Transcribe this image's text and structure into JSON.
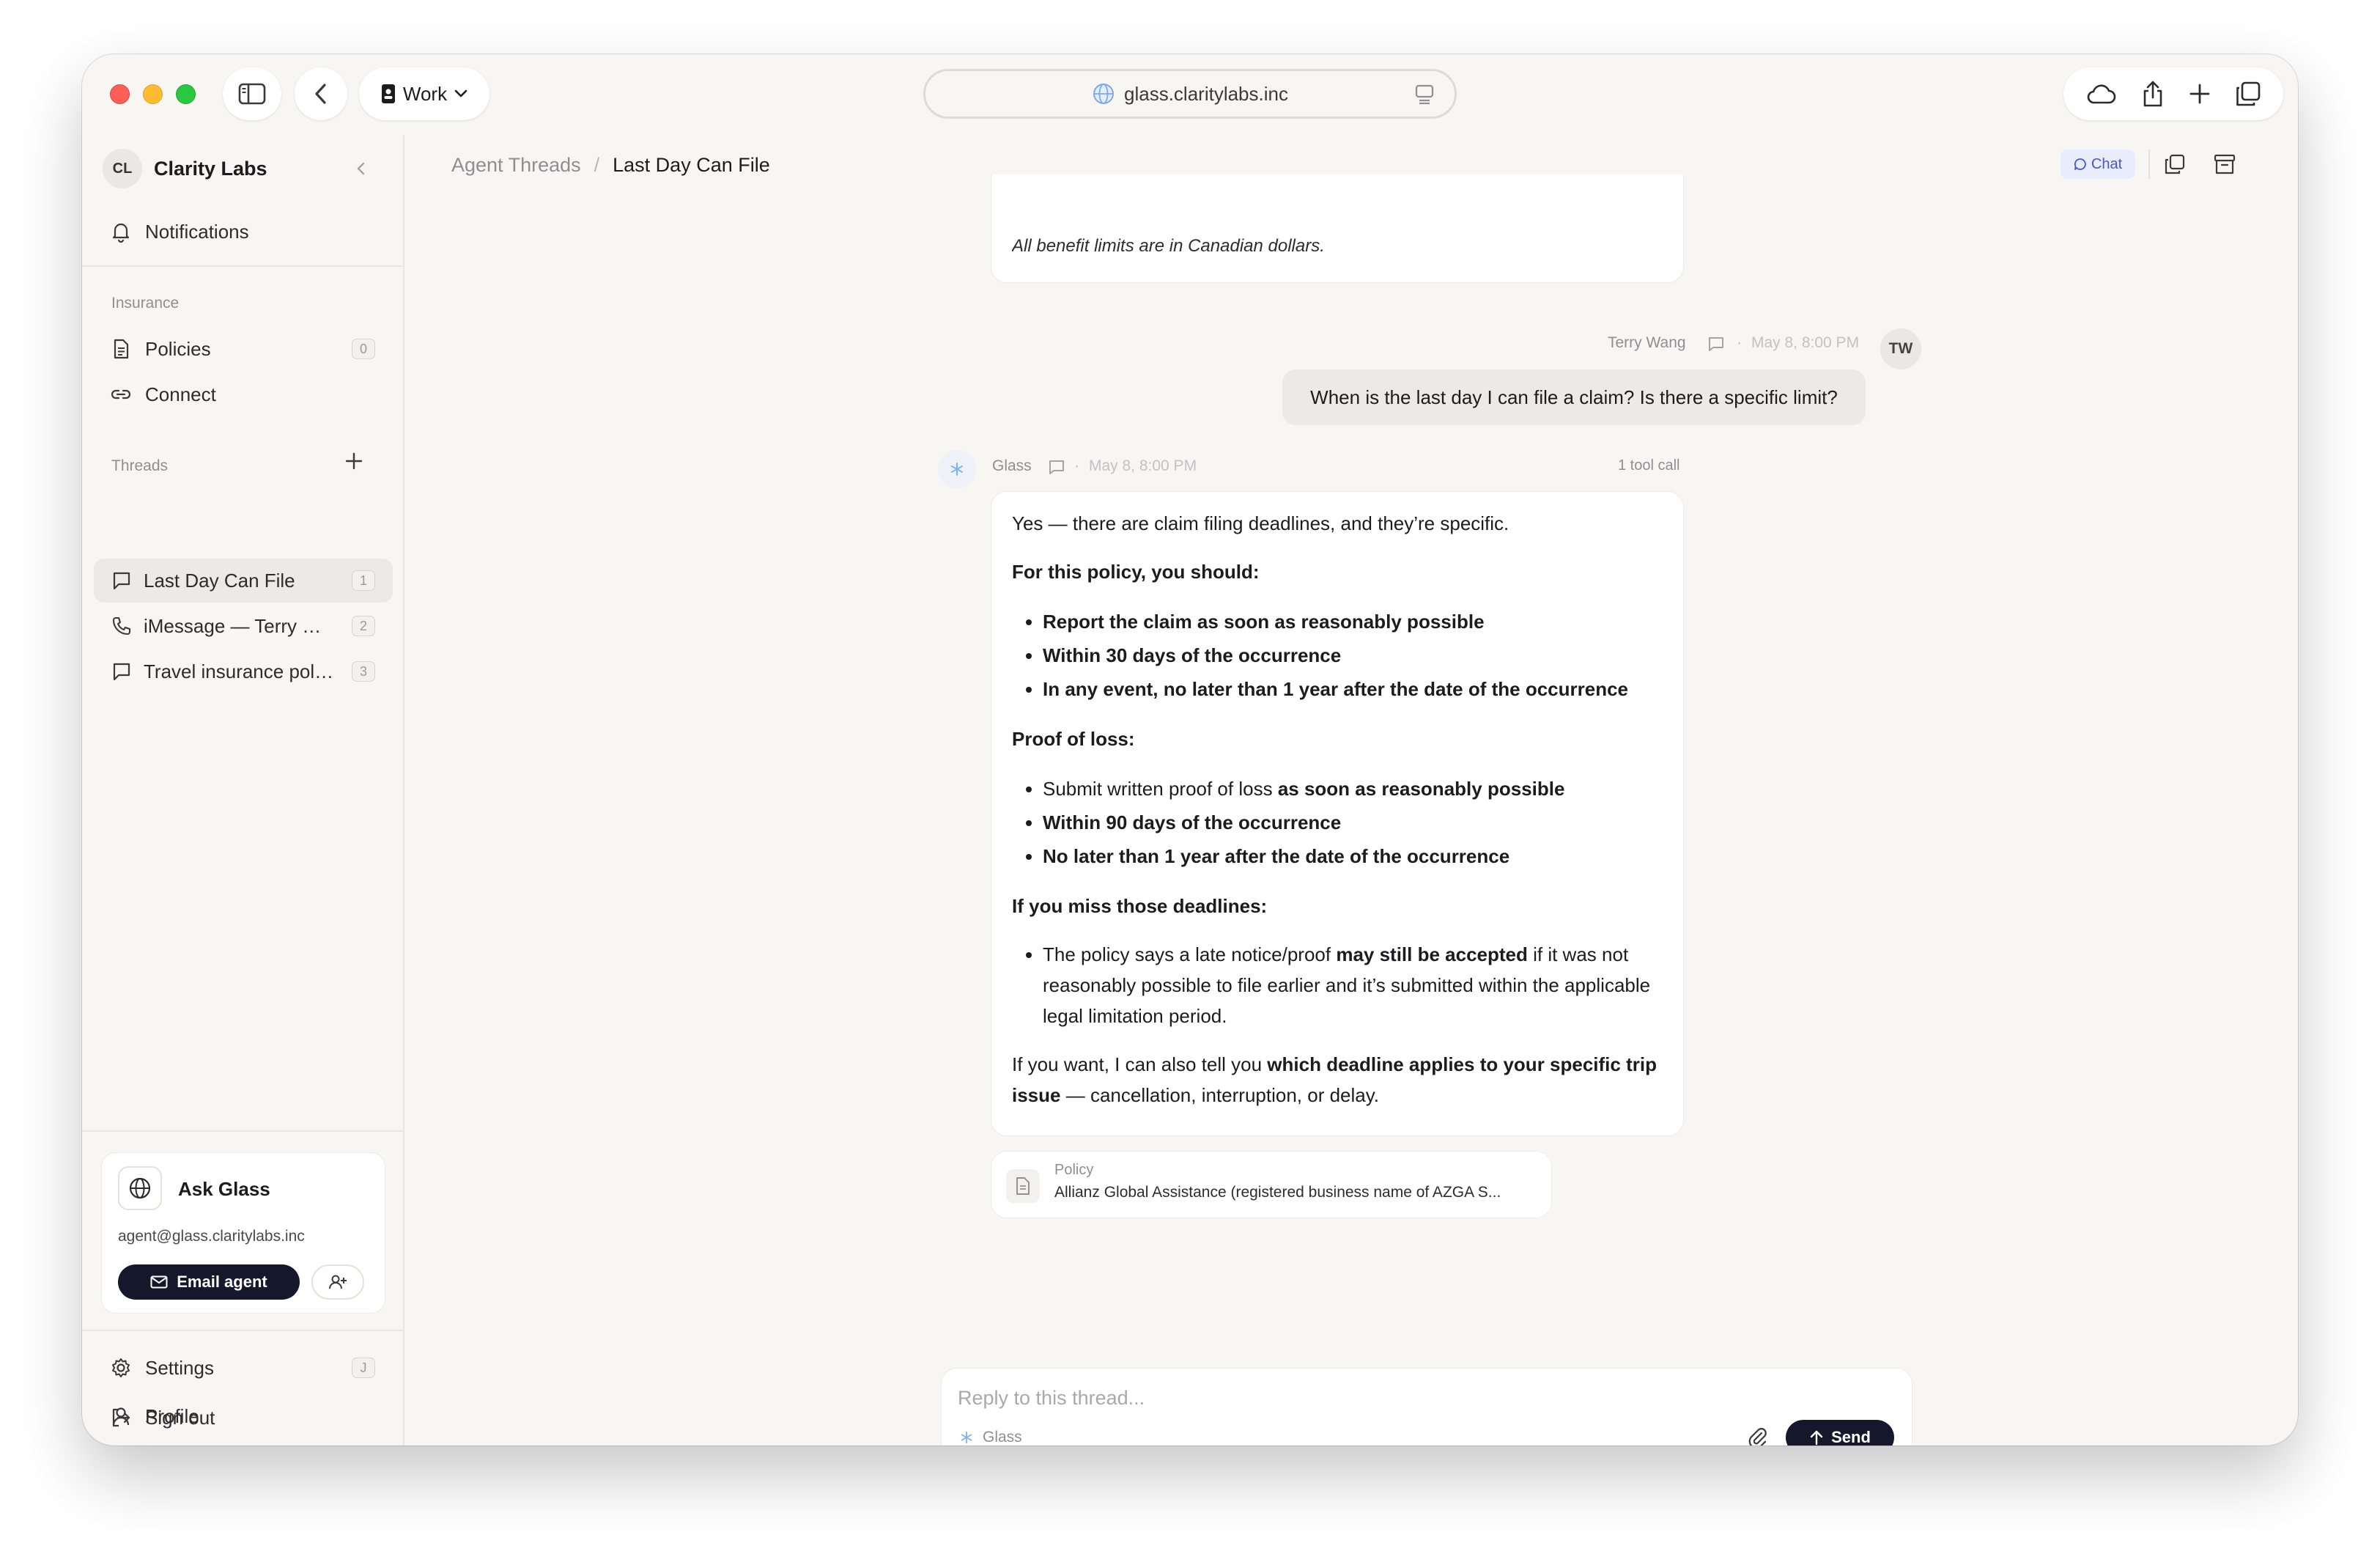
{
  "browser": {
    "profile_label": "Work",
    "url": "glass.claritylabs.inc"
  },
  "sidebar": {
    "org_initials": "CL",
    "org_name": "Clarity Labs",
    "notifications_label": "Notifications",
    "insurance_section": "Insurance",
    "insurance_items": [
      {
        "label": "Policies",
        "count": "0",
        "icon": "document-icon"
      },
      {
        "label": "Connect",
        "icon": "link-icon"
      }
    ],
    "threads_section": "Threads",
    "threads": [
      {
        "label": "Last Day Can File",
        "count": "1",
        "icon": "chat-bubble-icon",
        "active": true
      },
      {
        "label": "iMessage — Terry W...",
        "count": "2",
        "icon": "phone-icon"
      },
      {
        "label": "Travel insurance poli...",
        "count": "3",
        "icon": "chat-bubble-icon"
      }
    ],
    "ask_glass": {
      "title": "Ask Glass",
      "email": "agent@glass.claritylabs.inc",
      "email_button": "Email agent"
    },
    "footer": [
      {
        "label": "Settings",
        "shortcut": "J",
        "icon": "gear-icon"
      },
      {
        "label": "Profile",
        "icon": "user-icon"
      },
      {
        "label": "Sign out",
        "icon": "sign-out-icon"
      }
    ]
  },
  "header": {
    "breadcrumb_parent": "Agent Threads",
    "breadcrumb_sep": "/",
    "breadcrumb_current": "Last Day Can File",
    "chat_label": "Chat"
  },
  "thread": {
    "previous_text": "All benefit limits are in Canadian dollars.",
    "user_message": {
      "author": "Terry Wang",
      "initials": "TW",
      "time": "May 8, 8:00 PM",
      "text": "When is the last day I can file a claim? Is there a specific limit?"
    },
    "agent_message": {
      "author": "Glass",
      "time": "May 8, 8:00 PM",
      "tool_calls": "1 tool call",
      "intro": "Yes — there are claim filing deadlines, and they’re specific.",
      "heading1": "For this policy, you should:",
      "list1": [
        "Report the claim as soon as reasonably possible",
        "Within 30 days of the occurrence",
        "In any event, no later than 1 year after the date of the occurrence"
      ],
      "heading2": "Proof of loss:",
      "list2_item1_plain": "Submit written proof of loss ",
      "list2_item1_bold": "as soon as reasonably possible",
      "list2_item2": "Within 90 days of the occurrence",
      "list2_item3": "No later than 1 year after the date of the occurrence",
      "heading3": "If you miss those deadlines:",
      "list3_plain1": "The policy says a late notice/proof ",
      "list3_bold": "may still be accepted",
      "list3_plain2": " if it was not reasonably possible to file earlier and it’s submitted within the applicable legal limitation period.",
      "outro_plain1": "If you want, I can also tell you ",
      "outro_bold": "which deadline applies to your specific trip issue",
      "outro_plain2": " — cancellation, interruption, or delay."
    },
    "policy_card": {
      "label": "Policy",
      "name": "Allianz Global Assistance (registered business name of AZGA S..."
    }
  },
  "reply": {
    "placeholder": "Reply to this thread...",
    "agent": "Glass",
    "send_label": "Send"
  },
  "colors": {
    "accent": "#4456d6",
    "dark_button": "#15182b",
    "window_bg": "#f7f6f3"
  }
}
